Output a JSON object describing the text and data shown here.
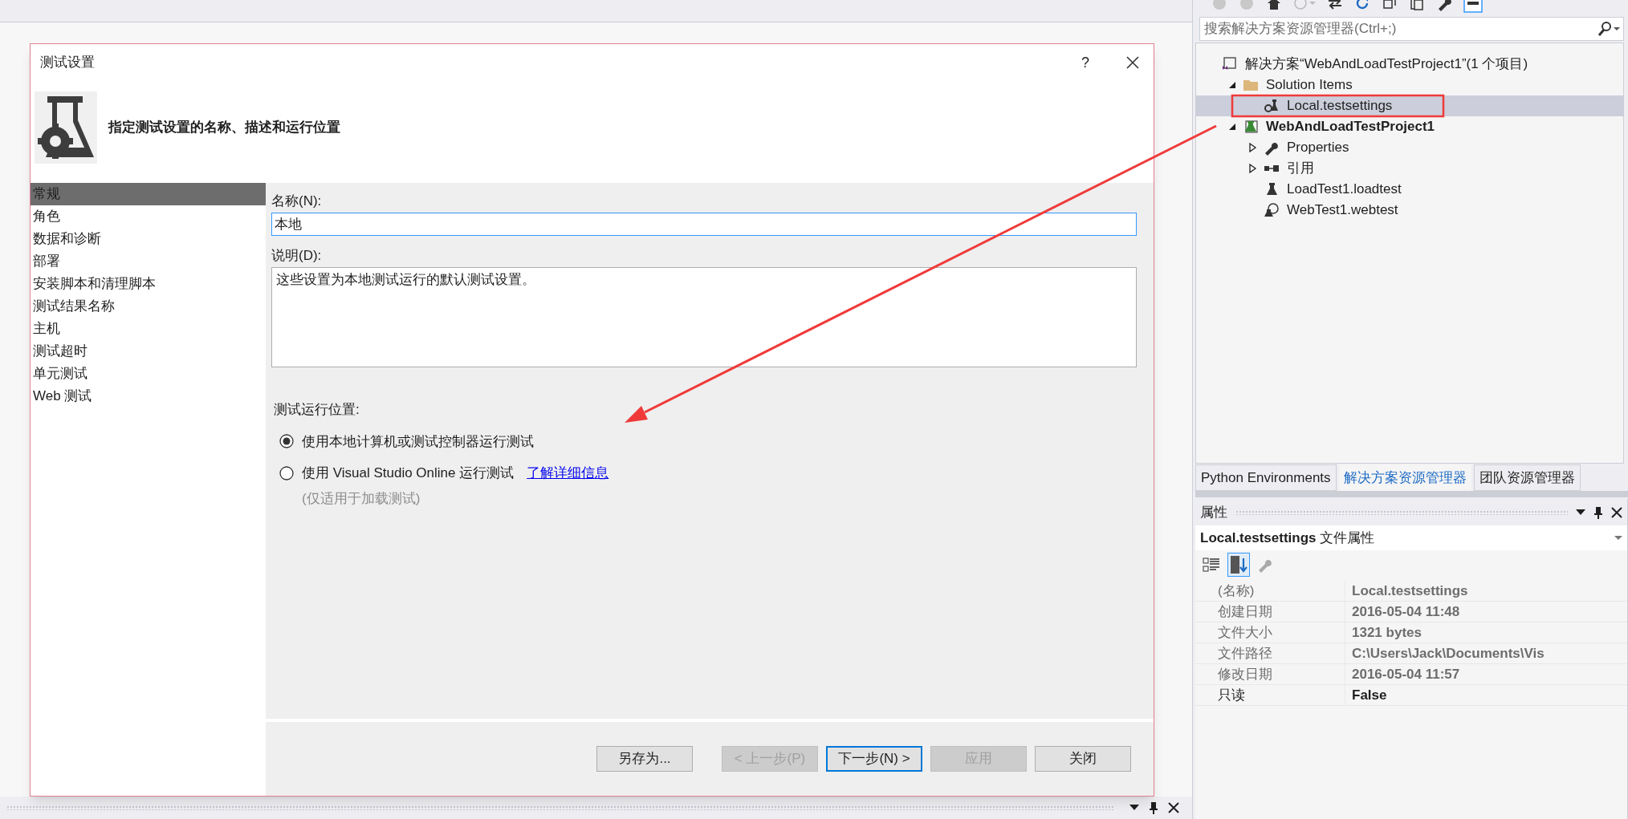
{
  "dialog": {
    "title": "测试设置",
    "help": "?",
    "heading": "指定测试设置的名称、描述和运行位置",
    "nav": [
      {
        "label": "常规",
        "selected": true
      },
      {
        "label": "角色",
        "selected": false
      },
      {
        "label": "数据和诊断",
        "selected": false
      },
      {
        "label": "部署",
        "selected": false
      },
      {
        "label": "安装脚本和清理脚本",
        "selected": false
      },
      {
        "label": "测试结果名称",
        "selected": false
      },
      {
        "label": "主机",
        "selected": false
      },
      {
        "label": "测试超时",
        "selected": false
      },
      {
        "label": "单元测试",
        "selected": false
      },
      {
        "label": "Web 测试",
        "selected": false
      }
    ],
    "name_field": {
      "label": "名称(N):",
      "value": "本地"
    },
    "description_field": {
      "label": "说明(D):",
      "value": "这些设置为本地测试运行的默认测试设置。"
    },
    "location": {
      "label": "测试运行位置:",
      "options": [
        {
          "label": "使用本地计算机或测试控制器运行测试",
          "selected": true
        },
        {
          "label": "使用 Visual Studio Online 运行测试",
          "selected": false,
          "link": "了解详细信息",
          "note": "(仅适用于加载测试)"
        }
      ]
    },
    "buttons": [
      {
        "label": "另存为...",
        "disabled": false,
        "focused": false
      },
      {
        "label": "< 上一步(P)",
        "disabled": true,
        "focused": false
      },
      {
        "label": "下一步(N) >",
        "disabled": false,
        "focused": true
      },
      {
        "label": "应用",
        "disabled": true,
        "focused": false
      },
      {
        "label": "关闭",
        "disabled": false,
        "focused": false
      }
    ]
  },
  "solution_explorer": {
    "search": {
      "placeholder": "搜索解决方案资源管理器(Ctrl+;)"
    },
    "tree": [
      {
        "label": "解决方案“WebAndLoadTestProject1”(1 个项目)",
        "kind": "solution",
        "selected": false,
        "children": [
          {
            "label": "Solution Items",
            "kind": "folder",
            "expanded": true,
            "selected": false,
            "children": [
              {
                "label": "Local.testsettings",
                "kind": "testsettings",
                "selected": true
              }
            ]
          },
          {
            "label": "WebAndLoadTestProject1",
            "kind": "project",
            "expanded": true,
            "selected": false,
            "children": [
              {
                "label": "Properties",
                "kind": "properties",
                "expanded": false,
                "selected": false
              },
              {
                "label": "引用",
                "kind": "references",
                "expanded": false,
                "selected": false
              },
              {
                "label": "LoadTest1.loadtest",
                "kind": "loadtest",
                "selected": false
              },
              {
                "label": "WebTest1.webtest",
                "kind": "webtest",
                "selected": false
              }
            ]
          }
        ]
      }
    ]
  },
  "tabs": [
    {
      "label": "Python Environments",
      "selected": false
    },
    {
      "label": "解决方案资源管理器",
      "selected": true
    },
    {
      "label": "团队资源管理器",
      "selected": false
    }
  ],
  "properties": {
    "title": "属性",
    "object": "Local.testsettings",
    "object_type": "文件属性",
    "toolbar": [
      {
        "kind": "categorized",
        "selected": false
      },
      {
        "kind": "alphabetical",
        "selected": true
      },
      {
        "kind": "property-pages",
        "selected": false
      }
    ],
    "rows": [
      {
        "name": "(名称)",
        "value": "Local.testsettings",
        "editable": false
      },
      {
        "name": "创建日期",
        "value": "2016-05-04 11:48",
        "editable": false
      },
      {
        "name": "文件大小",
        "value": "1321 bytes",
        "editable": false
      },
      {
        "name": "文件路径",
        "value": "C:\\Users\\Jack\\Documents\\Vis",
        "editable": false
      },
      {
        "name": "修改日期",
        "value": "2016-05-04 11:57",
        "editable": false
      },
      {
        "name": "只读",
        "value": "False",
        "editable": true
      }
    ]
  }
}
